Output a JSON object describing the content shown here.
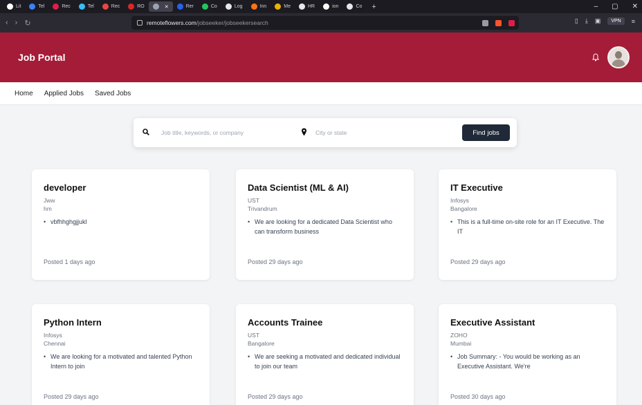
{
  "browser": {
    "tabs": [
      {
        "label": "Lit",
        "color": "#ffffff"
      },
      {
        "label": "Tel",
        "color": "#3b82f6"
      },
      {
        "label": "Rec",
        "color": "#e11d48"
      },
      {
        "label": "Tel",
        "color": "#38bdf8"
      },
      {
        "label": "Rec",
        "color": "#ef4444"
      },
      {
        "label": "RO",
        "color": "#dc2626"
      },
      {
        "label": "",
        "color": "#9ca3af",
        "active": true
      },
      {
        "label": "Rer",
        "color": "#2563eb"
      },
      {
        "label": "Co",
        "color": "#22c55e"
      },
      {
        "label": "Log",
        "color": "#e5e7eb"
      },
      {
        "label": "Inn",
        "color": "#f97316"
      },
      {
        "label": "Me",
        "color": "#eab308"
      },
      {
        "label": "HR",
        "color": "#e5e7eb"
      },
      {
        "label": "ion",
        "color": "#ffffff"
      },
      {
        "label": "Co",
        "color": "#e5e7eb"
      }
    ],
    "url_host": "remoteflowers.com",
    "url_path": "/jobseeker/jobseekersearch",
    "vpn_label": "VPN"
  },
  "app": {
    "brand": "Job Portal",
    "nav": [
      "Home",
      "Applied Jobs",
      "Saved Jobs"
    ]
  },
  "search": {
    "keyword_placeholder": "Job title, keywords, or company",
    "location_placeholder": "City or state",
    "button_label": "Find jobs"
  },
  "jobs": [
    {
      "title": "developer",
      "company": "Jww",
      "location": "hm",
      "description": "vbfhhghgjjukl",
      "posted": "Posted 1 days ago"
    },
    {
      "title": "Data Scientist (ML & AI)",
      "company": "UST",
      "location": "Trivandrum",
      "description": "We are looking for a dedicated Data Scientist who can transform business",
      "posted": "Posted 29 days ago"
    },
    {
      "title": "IT Executive",
      "company": "Infosys",
      "location": "Bangalore",
      "description": "This is a full-time on-site role for an IT Executive. The IT",
      "posted": "Posted 29 days ago"
    },
    {
      "title": "Python Intern",
      "company": "Infosys",
      "location": "Chennai",
      "description": "We are looking for a motivated and talented Python Intern to join",
      "posted": "Posted 29 days ago"
    },
    {
      "title": "Accounts Trainee",
      "company": "UST",
      "location": "Bangalore",
      "description": "We are seeking a motivated and dedicated individual to join our team",
      "posted": "Posted 29 days ago"
    },
    {
      "title": "Executive Assistant",
      "company": "ZOHO",
      "location": "Mumbai",
      "description": "Job Summary: - You would be working as an Executive Assistant. We're",
      "posted": "Posted 30 days ago"
    }
  ],
  "colors": {
    "brand": "#a51c38",
    "button": "#1f2937",
    "page_bg": "#f3f4f6"
  }
}
